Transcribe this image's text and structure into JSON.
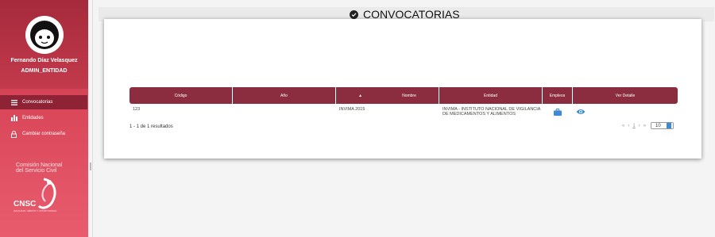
{
  "sidebar": {
    "user_name": "Fernando Díaz Velasquez",
    "user_role": "ADMIN_ENTIDAD",
    "items": [
      {
        "label": "Convocatorias",
        "icon": "list-icon",
        "active": true
      },
      {
        "label": "Entidades",
        "icon": "building-icon",
        "active": false
      },
      {
        "label": "Cambiar contraseña",
        "icon": "lock-icon",
        "active": false
      }
    ],
    "brand_line1": "Comisión Nacional",
    "brand_line2": "del Servicio Civil",
    "brand_acronym": "CNSC",
    "brand_slogan": "IGUALDAD, MÉRITO Y OPORTUNIDAD"
  },
  "header": {
    "title": "CONVOCATORIAS"
  },
  "table": {
    "columns": [
      "Código",
      "Año",
      "Nombre",
      "Entidad",
      "Empleos",
      "Ver Detalle"
    ],
    "sort_indicator": "▲",
    "rows": [
      {
        "codigo": "123",
        "anio": "",
        "nombre": "INVIMA 2015",
        "entidad": "INVIMA - INSTITUTO NACIONAL DE VIGILANCIA DE MEDICAMENTOS Y ALIMENTOS"
      }
    ]
  },
  "footer": {
    "results": "1 - 1 de 1 resultados",
    "pager": {
      "first": "«",
      "prev": "‹",
      "page": "1",
      "next": "›",
      "last": "»"
    },
    "page_size": "10"
  },
  "colors": {
    "accent": "#8b2d3e",
    "sidebar": "#d94759",
    "icon_blue": "#3b8ad8"
  }
}
